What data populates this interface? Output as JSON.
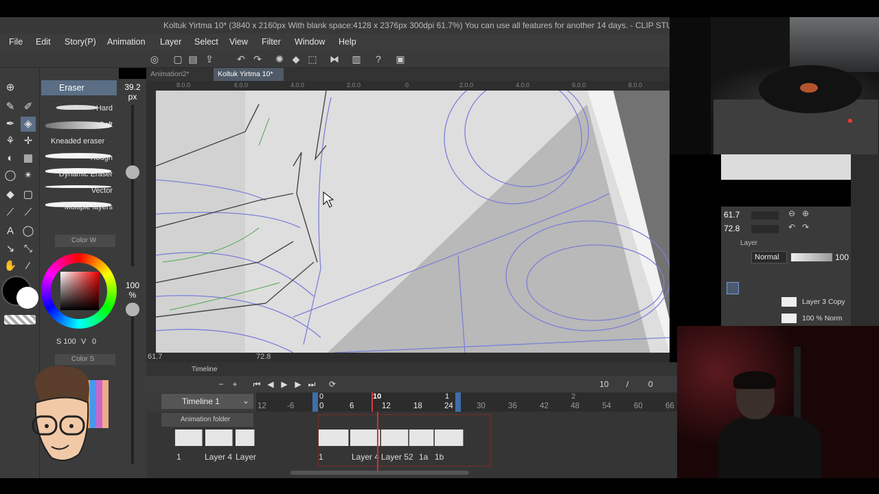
{
  "title_bar": {
    "text": "Koltuk Yirtma 10* (3840 x 2160px With blank space:4128 x 2376px 300dpi 61.7%)  You can use all features for another 14 days. - CLIP STUD"
  },
  "menu": [
    "File",
    "Edit",
    "Story(P)",
    "Animation",
    "Layer",
    "Select",
    "View",
    "Filter",
    "Window",
    "Help"
  ],
  "doc_tabs": [
    "Animation2*",
    "Koltuk Yirtma 10*"
  ],
  "sub_tool": {
    "header": "Eraser",
    "brushes": [
      "Hard",
      "Soft",
      "Kneaded eraser",
      "Rough",
      "Dynamic Eraser",
      "Vector",
      "Multiple layers"
    ]
  },
  "brush_size": {
    "value": "39.2",
    "unit": "px"
  },
  "brush_opacity": {
    "value": "100",
    "unit": "%"
  },
  "color_panel": {
    "tab": "Color W",
    "main_color": "#000000",
    "sub_color": "#ffffff",
    "s_value": "S 100",
    "v_value": "V",
    "extra_value": "0"
  },
  "color_set": {
    "tab": "Color S"
  },
  "ruler_labels": [
    "8.0.0",
    "6.0.0",
    "4.0.0",
    "2.0.0",
    "0",
    "2.0.0",
    "4.0.0",
    "6.0.0",
    "8.0.0"
  ],
  "canvas_status": {
    "zoom": "61.7",
    "angle": "72.8"
  },
  "timeline": {
    "panel_title": "Timeline",
    "name": "Timeline 1",
    "current_frame": "10",
    "slash": "/",
    "end_frame": "0",
    "top_numbers": [
      "0",
      "10",
      "1",
      "2"
    ],
    "frame_numbers": [
      "12",
      "-6",
      "0",
      "6",
      "12",
      "18",
      "24",
      "30",
      "36",
      "42",
      "48",
      "54",
      "60",
      "66"
    ],
    "folder_label": "Animation folder",
    "left_cell_labels": [
      "1",
      "Layer 4",
      "Layer"
    ],
    "cell_labels": [
      "1",
      "Layer 4",
      "Layer 52",
      "1a",
      "1b"
    ]
  },
  "navigator": {
    "zoom": "61.7",
    "angle": "72.8"
  },
  "layer_panel": {
    "title": "Layer",
    "blend_mode": "Normal",
    "opacity": "100",
    "rows": [
      {
        "name": "Layer 3 Copy"
      },
      {
        "name": "100 % Norm"
      }
    ]
  },
  "accent_color": "#5a6e86",
  "icons": [
    "pen-icon",
    "eraser-icon",
    "fill-icon",
    "text-icon",
    "hand-icon",
    "undo-icon",
    "play-icon"
  ]
}
